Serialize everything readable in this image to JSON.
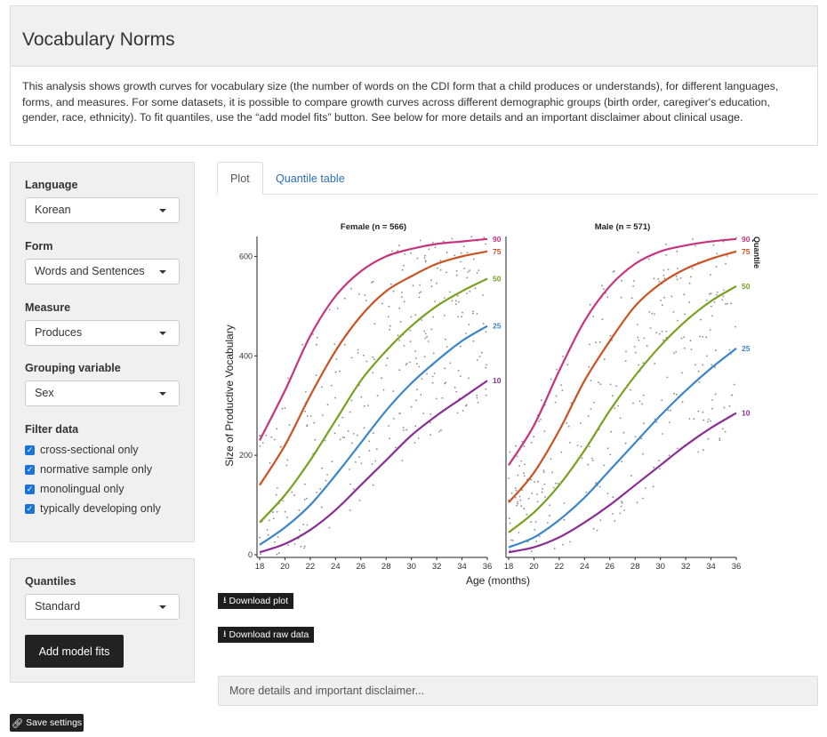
{
  "header": {
    "title": "Vocabulary Norms"
  },
  "intro": {
    "text": "This analysis shows growth curves for vocabulary size (the number of words on the CDI form that a child produces or understands), for different languages, forms, and measures. For some datasets, it is possible to compare growth curves across different demographic groups (birth order, caregiver's education, gender, race, ethnicity). To fit quantiles, use the “add model fits” button. See below for more details and an important disclaimer about clinical usage."
  },
  "sidebar": {
    "language": {
      "label": "Language",
      "value": "Korean"
    },
    "form": {
      "label": "Form",
      "value": "Words and Sentences"
    },
    "measure": {
      "label": "Measure",
      "value": "Produces"
    },
    "grouping": {
      "label": "Grouping variable",
      "value": "Sex"
    },
    "filter": {
      "label": "Filter data",
      "items": [
        {
          "label": "cross-sectional only",
          "checked": true
        },
        {
          "label": "normative sample only",
          "checked": true
        },
        {
          "label": "monolingual only",
          "checked": true
        },
        {
          "label": "typically developing only",
          "checked": true
        }
      ]
    }
  },
  "quantiles_panel": {
    "label": "Quantiles",
    "value": "Standard",
    "add_button": "Add model fits"
  },
  "save_settings": "Save settings",
  "tabs": [
    {
      "label": "Plot",
      "active": true
    },
    {
      "label": "Quantile table",
      "active": false
    }
  ],
  "buttons": {
    "download_plot": "Download plot",
    "download_raw": "Download raw data"
  },
  "details": {
    "label": "More details and important disclaimer..."
  },
  "colors": {
    "q90": "#c7347d",
    "q75": "#c95220",
    "q50": "#78a11f",
    "q25": "#3d85c9",
    "q10": "#8a2e95"
  },
  "chart_data": {
    "type": "line",
    "xlabel": "Age (months)",
    "ylabel": "Size of Productive Vocabulary",
    "legend_title": "Quantile",
    "xlim": [
      18,
      36
    ],
    "ylim": [
      0,
      640
    ],
    "x_ticks": [
      18,
      20,
      22,
      24,
      26,
      28,
      30,
      32,
      34,
      36
    ],
    "y_ticks": [
      0,
      200,
      400,
      600
    ],
    "x": [
      18,
      20,
      22,
      24,
      26,
      28,
      30,
      32,
      34,
      36
    ],
    "panels": [
      {
        "title": "Female (n = 566)",
        "series": [
          {
            "name": "90",
            "values": [
              230,
              330,
              440,
              520,
              570,
              600,
              615,
              625,
              630,
              635
            ]
          },
          {
            "name": "75",
            "values": [
              140,
              220,
              320,
              410,
              480,
              530,
              560,
              585,
              600,
              610
            ]
          },
          {
            "name": "50",
            "values": [
              65,
              120,
              190,
              270,
              350,
              410,
              460,
              500,
              530,
              555
            ]
          },
          {
            "name": "25",
            "values": [
              20,
              55,
              100,
              160,
              225,
              290,
              345,
              390,
              430,
              460
            ]
          },
          {
            "name": "10",
            "values": [
              5,
              22,
              50,
              90,
              140,
              190,
              240,
              280,
              315,
              350
            ]
          }
        ]
      },
      {
        "title": "Male (n = 571)",
        "series": [
          {
            "name": "90",
            "values": [
              180,
              260,
              370,
              470,
              540,
              585,
              610,
              622,
              630,
              635
            ]
          },
          {
            "name": "75",
            "values": [
              105,
              165,
              250,
              350,
              430,
              500,
              545,
              575,
              595,
              610
            ]
          },
          {
            "name": "50",
            "values": [
              45,
              85,
              140,
              210,
              290,
              360,
              420,
              470,
              510,
              540
            ]
          },
          {
            "name": "25",
            "values": [
              15,
              35,
              70,
              115,
              170,
              225,
              280,
              330,
              375,
              415
            ]
          },
          {
            "name": "10",
            "values": [
              5,
              15,
              35,
              65,
              100,
              140,
              180,
              220,
              255,
              285
            ]
          }
        ]
      }
    ]
  }
}
